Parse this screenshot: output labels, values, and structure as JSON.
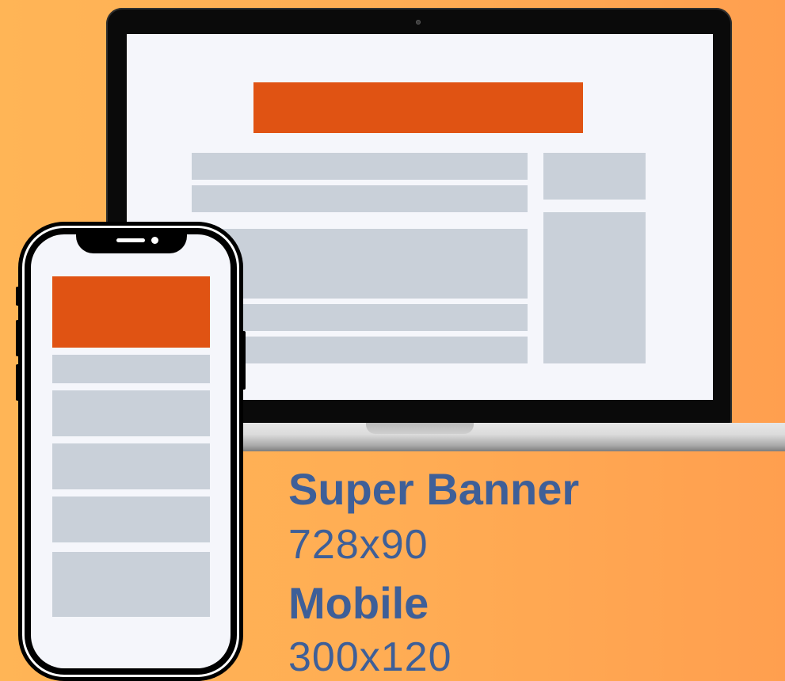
{
  "colors": {
    "background_start": "#ffb556",
    "background_end": "#ff9f4f",
    "banner": "#e05313",
    "content_placeholder": "#c9d0d9",
    "screen": "#f5f6fb",
    "text": "#3e5f98"
  },
  "formats": [
    {
      "name": "Super Banner",
      "size": "728x90"
    },
    {
      "name": "Mobile",
      "size": "300x120"
    }
  ],
  "icons": {
    "laptop": "laptop-icon",
    "phone": "phone-icon"
  }
}
